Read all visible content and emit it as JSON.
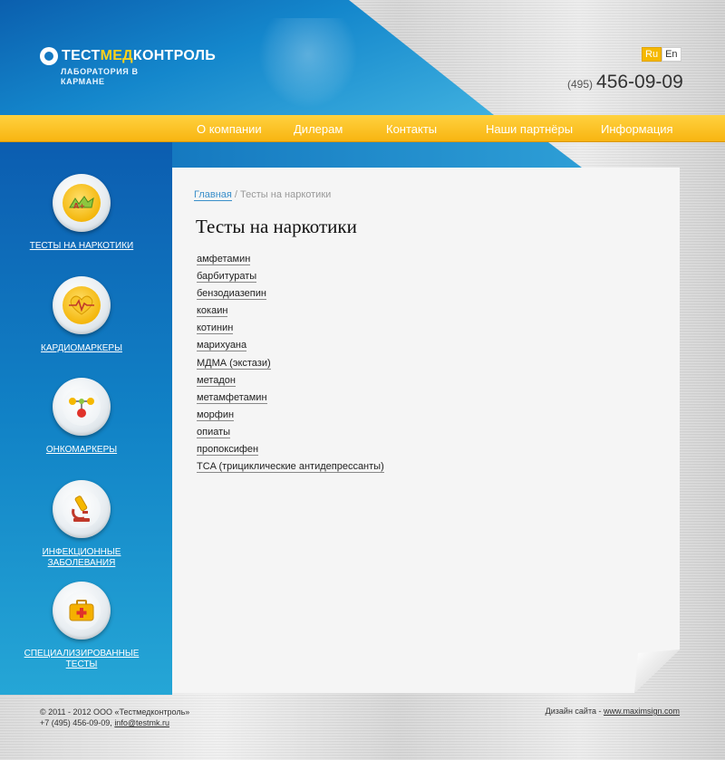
{
  "header": {
    "logo_main": "ТЕСТ",
    "logo_accent": "МЕД",
    "logo_rest": "КОНТРОЛЬ",
    "tagline": "ЛАБОРАТОРИЯ В КАРМАНЕ",
    "lang_ru": "Ru",
    "lang_en": "En",
    "phone_code": "(495)",
    "phone_number": "456-09-09"
  },
  "nav": {
    "items": [
      {
        "label": "О компании"
      },
      {
        "label": "Дилерам"
      },
      {
        "label": "Контакты"
      },
      {
        "label": "Наши партнёры"
      },
      {
        "label": "Информация"
      }
    ]
  },
  "sidebar": {
    "items": [
      {
        "label": "ТЕСТЫ НА НАРКОТИКИ",
        "icon": "drug-test-icon"
      },
      {
        "label": "КАРДИОМАРКЕРЫ",
        "icon": "heart-icon"
      },
      {
        "label": "ОНКОМАРКЕРЫ",
        "icon": "molecule-icon"
      },
      {
        "label": "ИНФЕКЦИОННЫЕ ЗАБОЛЕВАНИЯ",
        "icon": "microscope-icon"
      },
      {
        "label": "СПЕЦИАЛИЗИРОВАННЫЕ ТЕСТЫ",
        "icon": "first-aid-kit-icon"
      }
    ]
  },
  "main": {
    "breadcrumb_home": "Главная",
    "breadcrumb_sep": " / ",
    "breadcrumb_current": "Тесты на наркотики",
    "title": "Тесты на наркотики",
    "items": [
      "амфетамин",
      "барбитураты",
      "бензодиазепин",
      "кокаин",
      "котинин",
      "марихуана",
      "МДМА (экстази)",
      "метадон",
      "метамфетамин",
      "морфин",
      "опиаты",
      "пропоксифен",
      "TCA (трициклические антидепрессанты)"
    ]
  },
  "footer": {
    "copyright": "© 2011 - 2012 ООО «Тестмедконтроль»",
    "phone_line": "+7 (495) 456-09-09, ",
    "email": "info@testmk.ru",
    "design_label": "Дизайн сайта - ",
    "design_link": "www.maximsign.com"
  }
}
